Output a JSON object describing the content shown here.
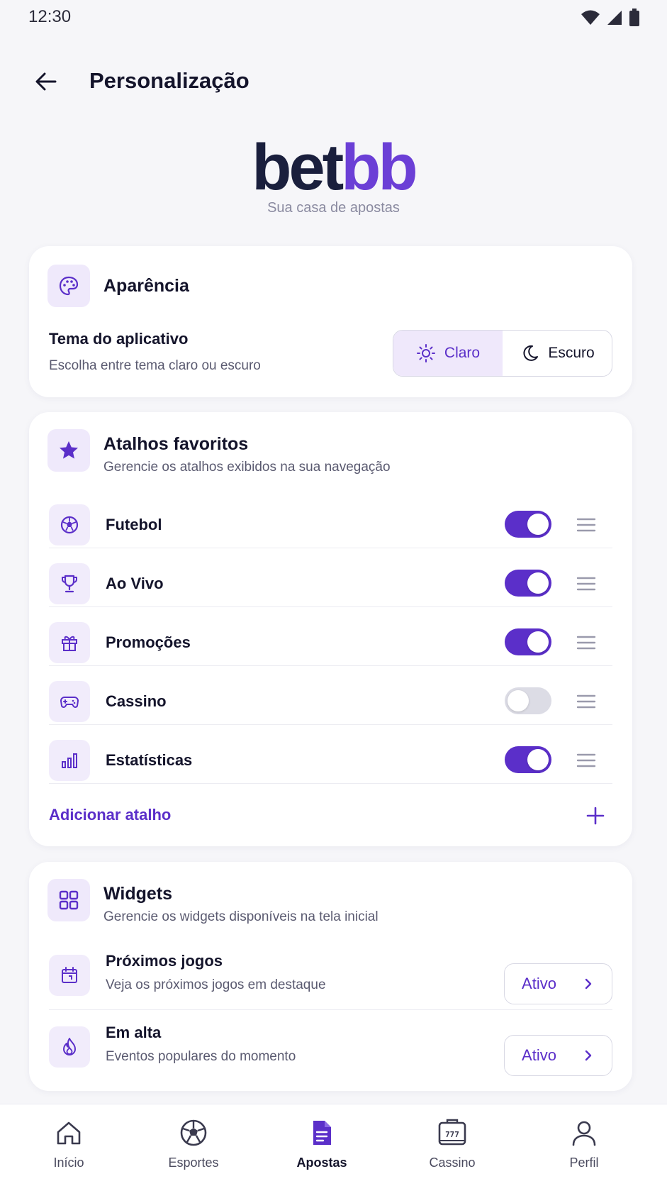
{
  "status_bar": {
    "time": "12:30"
  },
  "header": {
    "title": "Personalização"
  },
  "logo": {
    "part1": "bet",
    "part2": "bb",
    "tagline": "Sua casa de apostas"
  },
  "appearance": {
    "title": "Aparência",
    "theme_label": "Tema do aplicativo",
    "theme_desc": "Escolha entre tema claro ou escuro",
    "options": [
      {
        "label": "Claro",
        "icon": "sun-icon",
        "selected": true
      },
      {
        "label": "Escuro",
        "icon": "moon-icon",
        "selected": false
      }
    ]
  },
  "shortcuts": {
    "title": "Atalhos favoritos",
    "subtitle": "Gerencie os atalhos exibidos na sua navegação",
    "items": [
      {
        "label": "Futebol",
        "icon": "soccer-ball-icon",
        "enabled": true
      },
      {
        "label": "Ao Vivo",
        "icon": "trophy-icon",
        "enabled": true
      },
      {
        "label": "Promoções",
        "icon": "gift-icon",
        "enabled": true
      },
      {
        "label": "Cassino",
        "icon": "gamepad-icon",
        "enabled": false
      },
      {
        "label": "Estatísticas",
        "icon": "bar-chart-icon",
        "enabled": true
      }
    ],
    "add_label": "Adicionar atalho"
  },
  "widgets": {
    "title": "Widgets",
    "subtitle": "Gerencie os widgets disponíveis na tela inicial",
    "items": [
      {
        "title": "Próximos jogos",
        "desc": "Veja os próximos jogos em destaque",
        "status": "Ativo",
        "icon": "calendar-icon"
      },
      {
        "title": "Em alta",
        "desc": "Eventos populares do momento",
        "status": "Ativo",
        "icon": "flame-icon"
      }
    ]
  },
  "bottom_nav": {
    "items": [
      {
        "label": "Início",
        "icon": "home-icon",
        "active": false
      },
      {
        "label": "Esportes",
        "icon": "soccer-ball-icon",
        "active": false
      },
      {
        "label": "Apostas",
        "icon": "bet-slip-icon",
        "active": true
      },
      {
        "label": "Cassino",
        "icon": "slot-machine-icon",
        "active": false
      },
      {
        "label": "Perfil",
        "icon": "user-icon",
        "active": false
      }
    ]
  },
  "colors": {
    "accent": "#5b2fc9",
    "accent_soft": "#efe8fb",
    "brand_dark": "#1a1f3d",
    "background": "#f6f6f9"
  }
}
